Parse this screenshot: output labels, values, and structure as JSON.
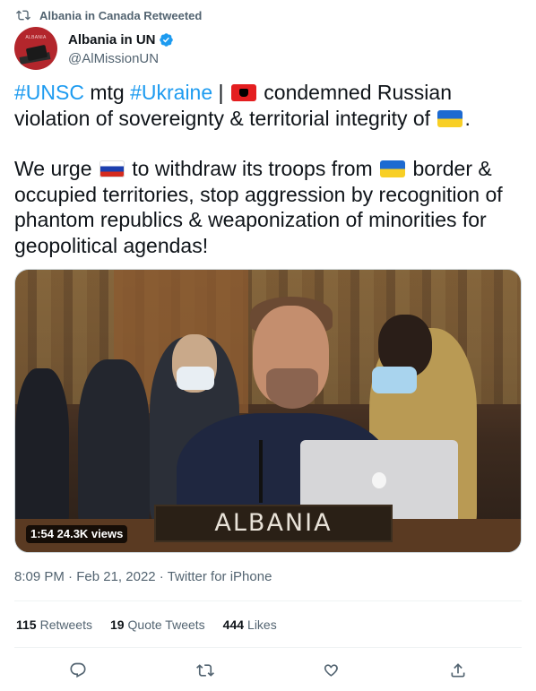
{
  "retweet": {
    "text": "Albania in Canada Retweeted",
    "icon": "retweet-icon"
  },
  "author": {
    "name": "Albania in UN",
    "handle": "@AlMissionUN",
    "verified": true,
    "avatar_text": "ALBANIA"
  },
  "tweet": {
    "line1_tag1": "#UNSC",
    "line1_word": " mtg ",
    "line1_tag2": "#Ukraine",
    "line1_sep": " | ",
    "line1_rest": " condemned Russian violation of sovereignty & territorial integrity of ",
    "line1_end": ".",
    "line2_start": "We urge ",
    "line2_mid1": " to withdraw its troops from ",
    "line2_mid2": " border & occupied territories, stop aggression by recognition of phantom republics & weaponization of minorities for geopolitical agendas!",
    "flags": [
      "albania-flag",
      "ukraine-flag",
      "russia-flag",
      "ukraine-flag"
    ]
  },
  "media": {
    "nameplate": "ALBANIA",
    "badge": "1:54  24.3K views"
  },
  "meta": {
    "time": "8:09 PM",
    "sep1": " · ",
    "date": "Feb 21, 2022",
    "sep2": " · ",
    "source": "Twitter for iPhone"
  },
  "stats": {
    "retweets_count": "115",
    "retweets_label": "Retweets",
    "quotes_count": "19",
    "quotes_label": "Quote Tweets",
    "likes_count": "444",
    "likes_label": "Likes"
  },
  "colors": {
    "link": "#1d9bf0",
    "secondary": "#536471",
    "text": "#0f1419"
  },
  "actions": [
    "reply-icon",
    "retweet-icon",
    "like-icon",
    "share-icon"
  ]
}
